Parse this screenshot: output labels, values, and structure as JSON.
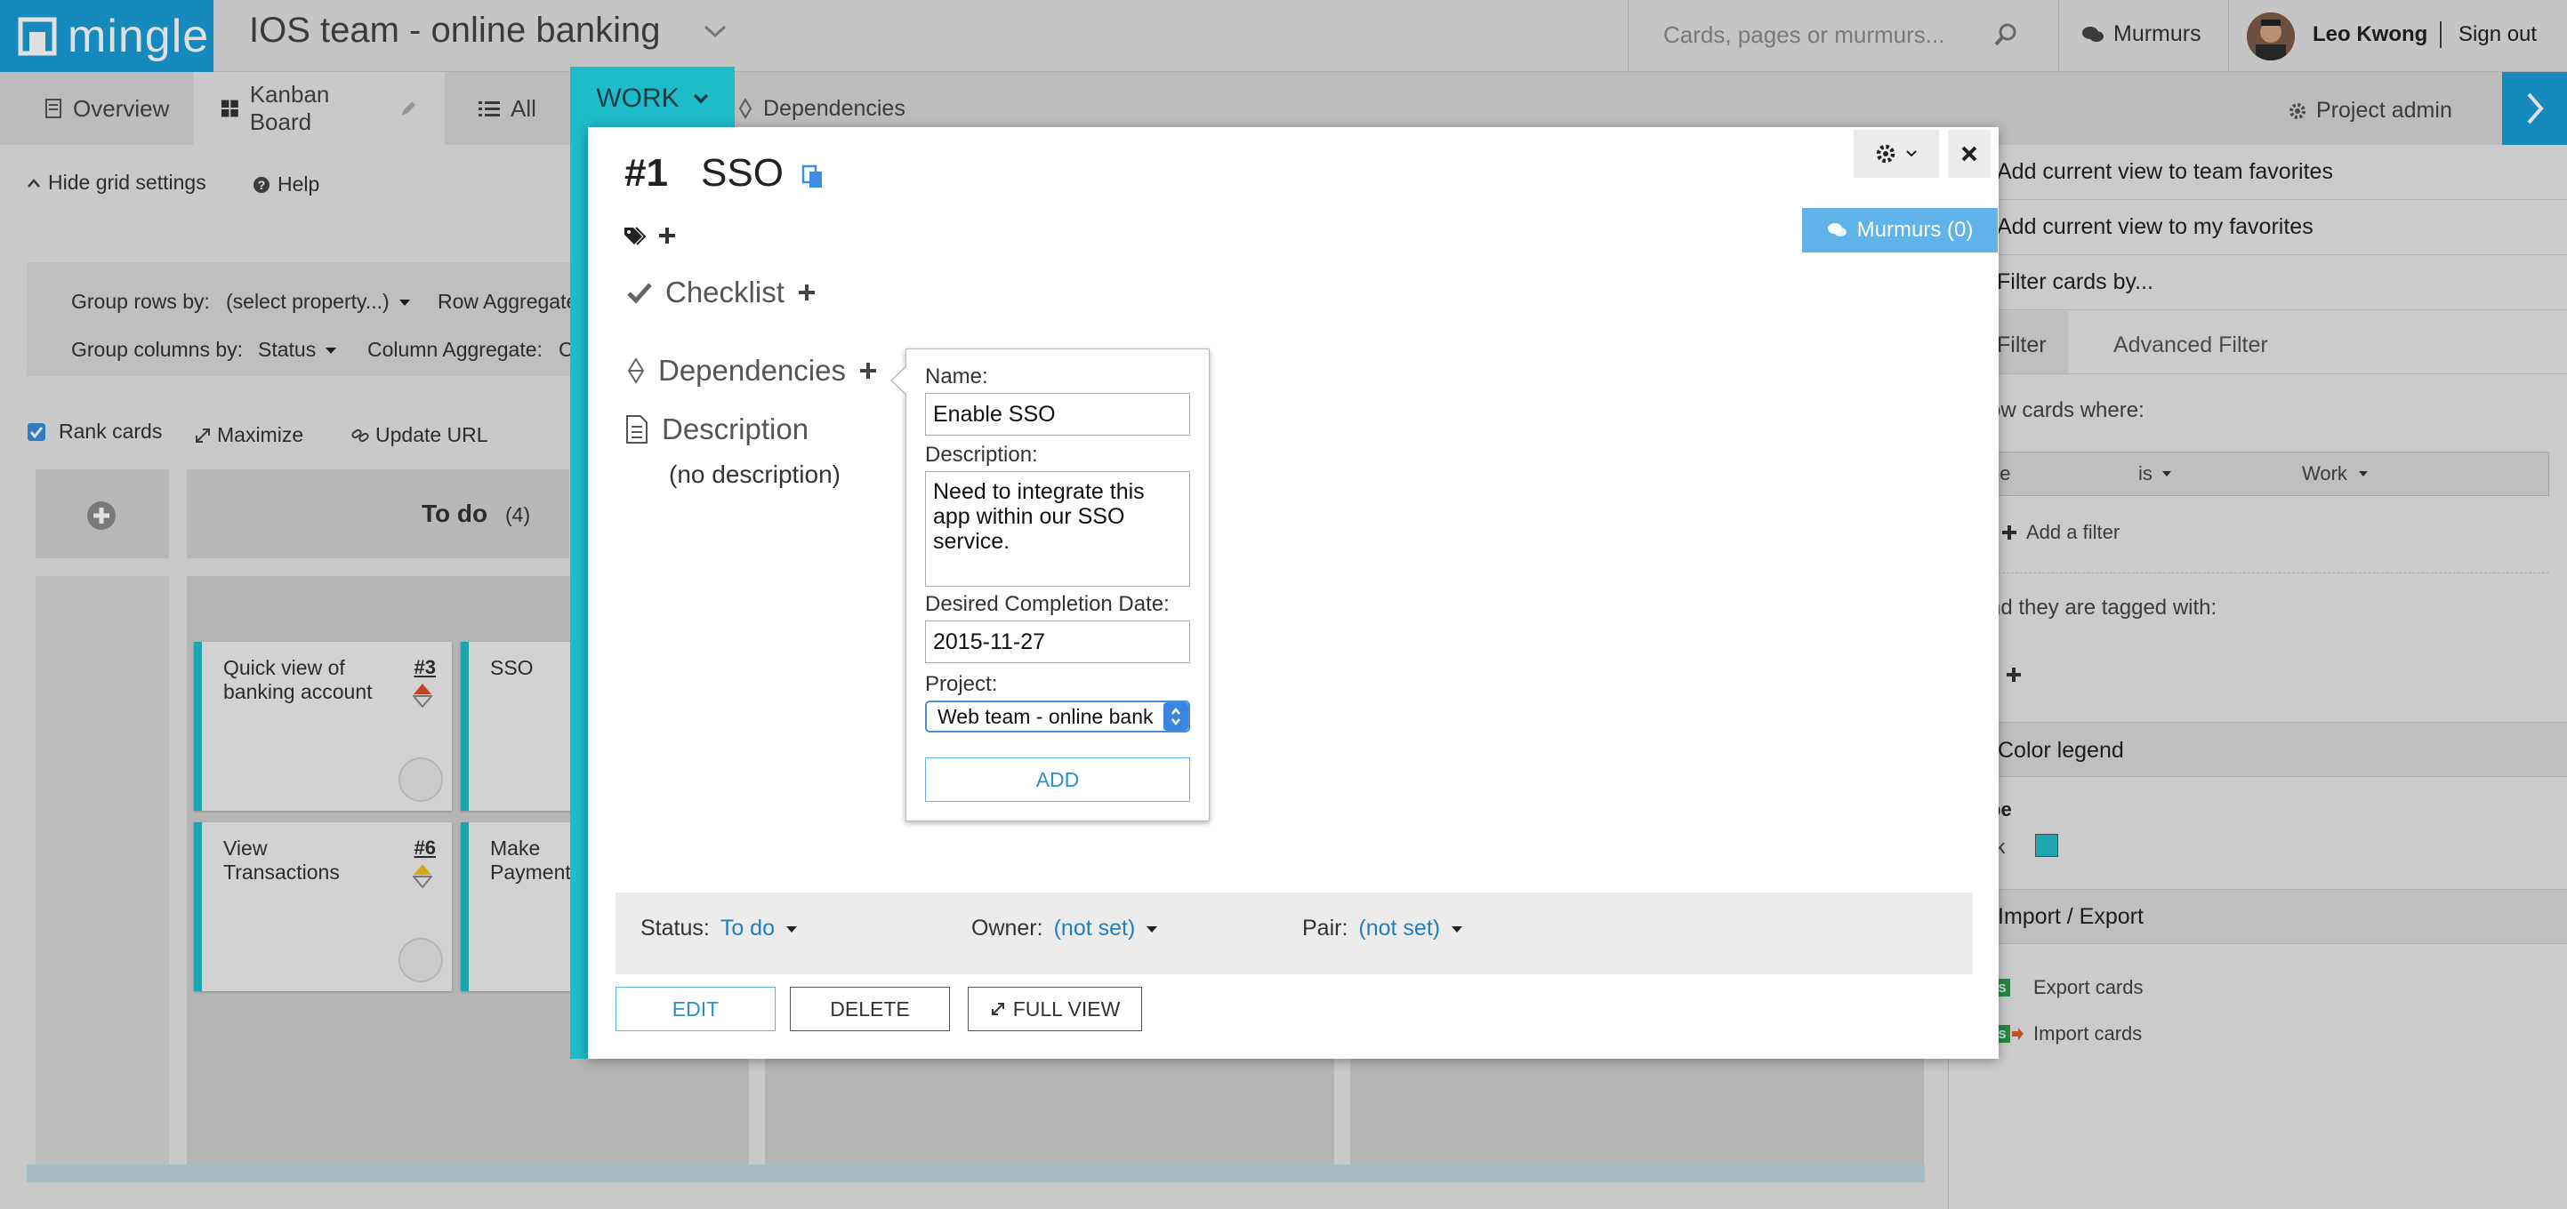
{
  "app": {
    "logo_text": "mingle",
    "project_title": "IOS team - online banking"
  },
  "topbar": {
    "search_placeholder": "Cards, pages or murmurs...",
    "murmurs_label": "Murmurs",
    "user_name": "Leo Kwong",
    "signout_label": "Sign out"
  },
  "tabs": [
    {
      "label": "Overview"
    },
    {
      "label": "Kanban Board"
    },
    {
      "label": "All"
    },
    {
      "label": "Dependencies"
    }
  ],
  "work_button": "WORK",
  "project_admin": "Project admin",
  "grid": {
    "hide_settings": "Hide grid settings",
    "help": "Help",
    "group_rows_label": "Group rows by:",
    "group_rows_value": "(select property...)",
    "row_aggregate_label": "Row Aggregate",
    "group_columns_label": "Group columns by:",
    "group_columns_value": "Status",
    "column_aggregate_label": "Column Aggregate:",
    "column_aggregate_value": "C",
    "rank_cards": "Rank cards",
    "maximize": "Maximize",
    "update_url": "Update URL",
    "column_todo": "To do",
    "column_todo_count": "(4)"
  },
  "cards": [
    {
      "title": "Quick view of banking account",
      "number": "#3"
    },
    {
      "title": "SSO",
      "number": ""
    },
    {
      "title": "View Transactions",
      "number": "#6"
    },
    {
      "title": "Make Payment/",
      "number": ""
    }
  ],
  "right_panel": {
    "fav_team": "Add current view to team favorites",
    "fav_mine": "Add current view to my favorites",
    "filter_by": "Filter cards by...",
    "filter_tab": "Filter",
    "advanced_tab": "Advanced Filter",
    "show_cards_where": "ow cards where:",
    "filter_col1": "pe",
    "filter_col2": "is",
    "filter_col3": "Work",
    "add_filter": "Add a filter",
    "tagged_with": "nd they are tagged with:",
    "color_legend": "Color legend",
    "legend_heading": "pe",
    "legend_item": "rk",
    "legend_color": "#1ebcc8",
    "import_export": "Import / Export",
    "export_cards": "Export cards",
    "import_cards": "Import cards"
  },
  "card_modal": {
    "number": "#1",
    "name": "SSO",
    "murmurs_button": "Murmurs (0)",
    "checklist": "Checklist",
    "dependencies": "Dependencies",
    "description": "Description",
    "no_description": "(no description)",
    "status_label": "Status:",
    "status_value": "To do",
    "owner_label": "Owner:",
    "owner_value": "(not set)",
    "pair_label": "Pair:",
    "pair_value": "(not set)",
    "edit_button": "EDIT",
    "delete_button": "DELETE",
    "full_view_button": "FULL VIEW"
  },
  "dependency_form": {
    "name_label": "Name:",
    "name_value": "Enable SSO",
    "description_label": "Description:",
    "description_value": "Need to integrate this app within our SSO service.",
    "date_label": "Desired Completion Date:",
    "date_value": "2015-11-27",
    "project_label": "Project:",
    "project_value": "Web team - online bank",
    "add_button": "ADD"
  },
  "colors": {
    "brand": "#1a9ed8",
    "card_accent": "#1ebcc8",
    "link": "#1f7fc0"
  }
}
